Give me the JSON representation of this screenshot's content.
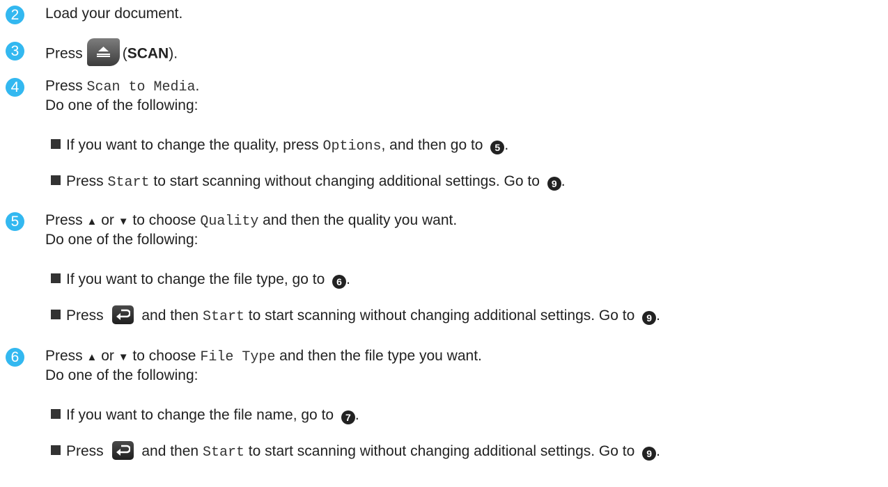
{
  "steps": [
    {
      "num": "2",
      "lines": [
        "Load your document."
      ]
    },
    {
      "num": "3",
      "pre": "Press",
      "post_open": "(",
      "bold": "SCAN",
      "post_close": ")."
    },
    {
      "num": "4",
      "pre": "Press ",
      "mono": "Scan to Media",
      "post": ".",
      "line2": "Do one of the following:",
      "bullets": [
        {
          "pre": "If you want to change the quality, press ",
          "mono": "Options",
          "mid": ", and then go to ",
          "ref": "5",
          "post": "."
        },
        {
          "pre": "Press ",
          "mono": "Start",
          "mid": " to start scanning without changing additional settings. Go to ",
          "ref": "9",
          "post": "."
        }
      ]
    },
    {
      "num": "5",
      "pre": "Press ",
      "up": "▲",
      "or": " or ",
      "down": "▼",
      "mid": " to choose ",
      "mono": "Quality",
      "post": " and then the quality you want.",
      "line2": "Do one of the following:",
      "bullets": [
        {
          "pre": "If you want to change the file type, go to ",
          "ref": "6",
          "post": "."
        },
        {
          "pre": "Press ",
          "mid": " and then ",
          "mono": "Start",
          "post": " to start scanning without changing additional settings. Go to ",
          "ref": "9",
          "end": "."
        }
      ]
    },
    {
      "num": "6",
      "pre": "Press ",
      "up": "▲",
      "or": " or ",
      "down": "▼",
      "mid": " to choose ",
      "mono": "File Type",
      "post": " and then the file type you want.",
      "line2": "Do one of the following:",
      "bullets": [
        {
          "pre": "If you want to change the file name, go to ",
          "ref": "7",
          "post": "."
        },
        {
          "pre": "Press ",
          "mid": " and then ",
          "mono": "Start",
          "post": " to start scanning without changing additional settings. Go to ",
          "ref": "9",
          "end": "."
        }
      ]
    }
  ],
  "icons": {
    "scan_button": "scan-icon",
    "back_button": "back-arrow-icon"
  },
  "colors": {
    "step_circle": "#33b8f0",
    "ref_circle": "#222222"
  }
}
